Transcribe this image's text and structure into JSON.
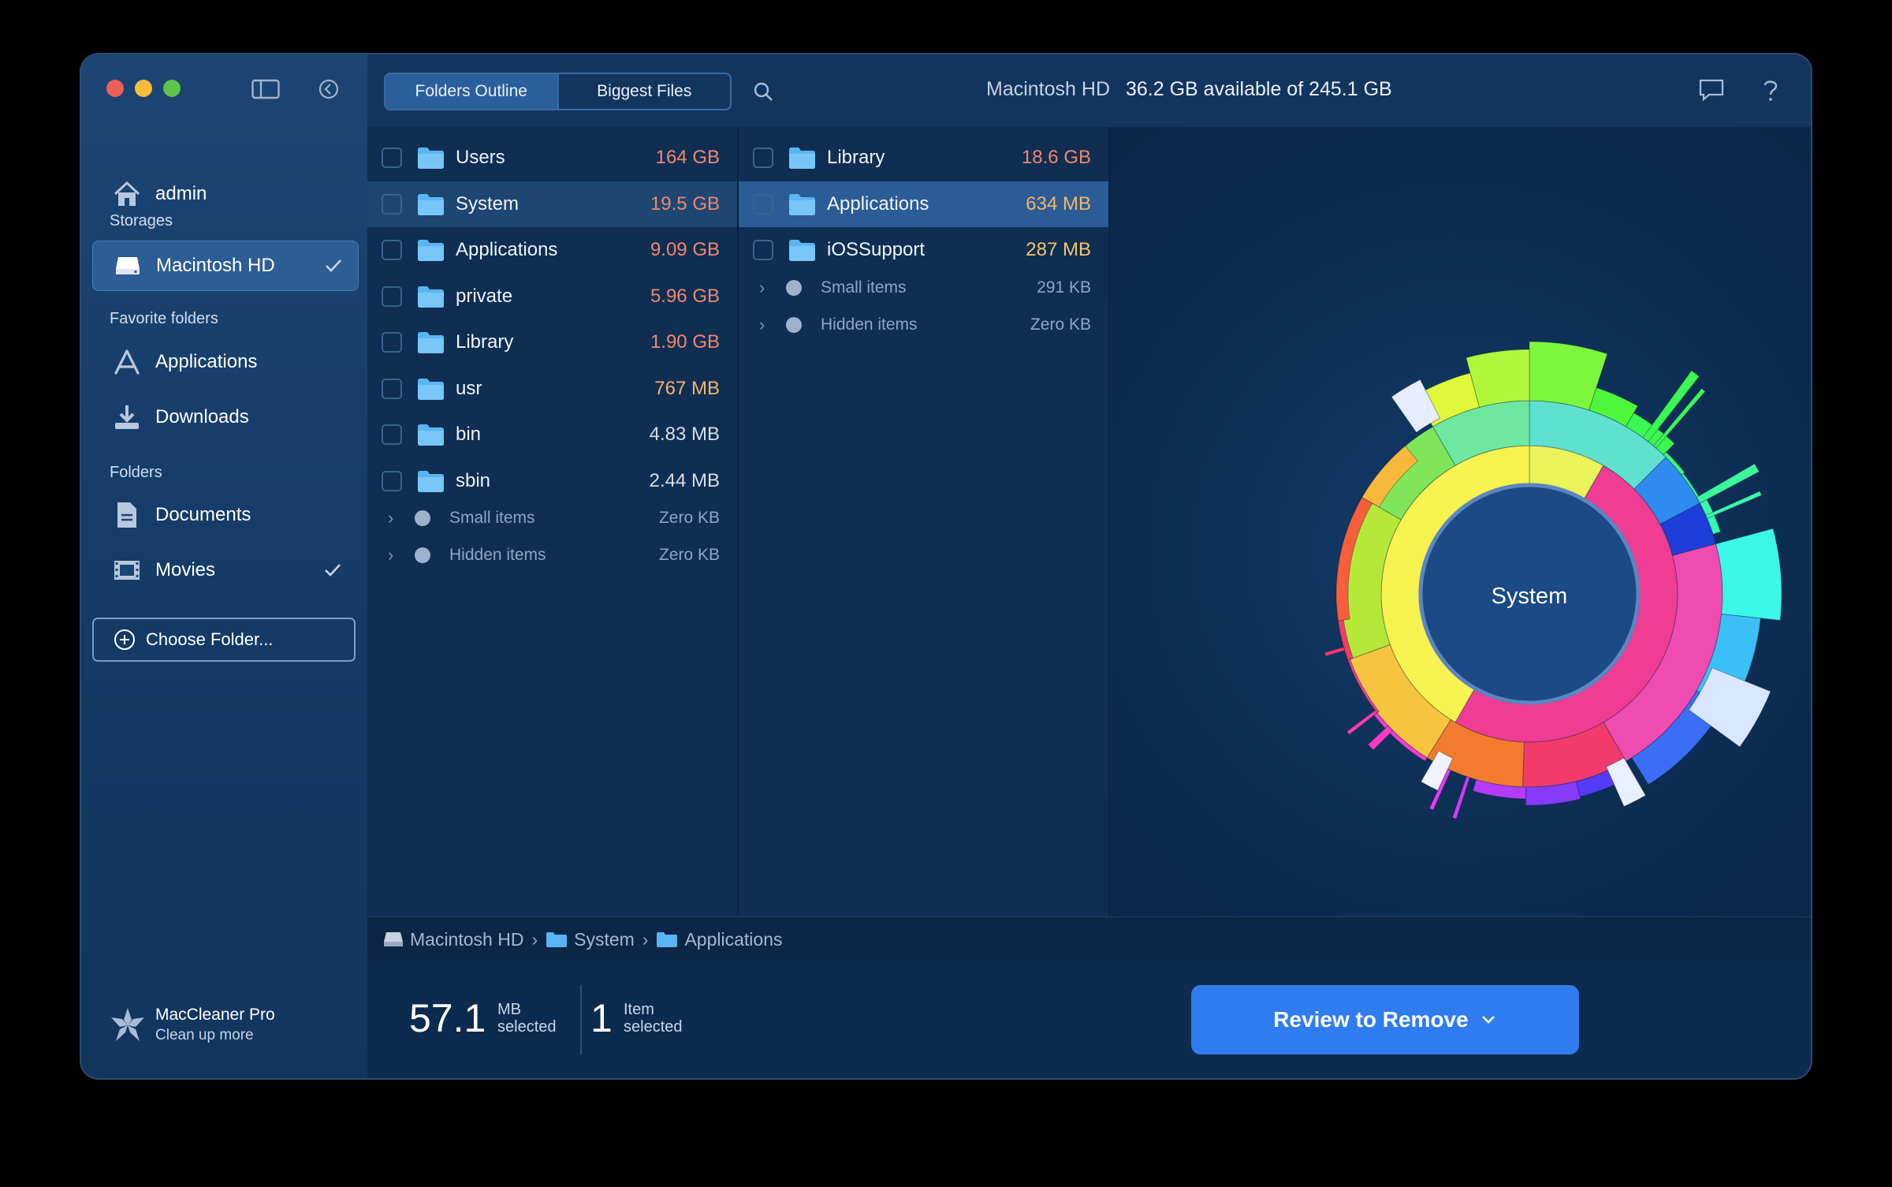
{
  "window": {
    "title_info": {
      "disk_name": "Macintosh HD",
      "availability": "36.2 GB available of 245.1 GB"
    }
  },
  "sidebar": {
    "user": {
      "label": "admin",
      "icon": "home-icon"
    },
    "storages_header": "Storages",
    "storages": [
      {
        "label": "Macintosh HD",
        "icon": "drive-icon",
        "selected": true,
        "checked": true
      }
    ],
    "favorites_header": "Favorite folders",
    "favorites": [
      {
        "label": "Applications",
        "icon": "app-store-icon"
      },
      {
        "label": "Downloads",
        "icon": "download-icon"
      }
    ],
    "folders_header": "Folders",
    "folders": [
      {
        "label": "Documents",
        "icon": "document-icon"
      },
      {
        "label": "Movies",
        "icon": "film-icon",
        "checked": true
      }
    ],
    "choose_folder": "Choose Folder...",
    "brand": {
      "name": "MacCleaner Pro",
      "tagline": "Clean up more"
    }
  },
  "toolbar": {
    "tabs": [
      {
        "label": "Folders Outline",
        "active": true
      },
      {
        "label": "Biggest Files",
        "active": false
      }
    ]
  },
  "column1": {
    "rows": [
      {
        "name": "Users",
        "size": "164 GB",
        "color": "#f0876f"
      },
      {
        "name": "System",
        "size": "19.5 GB",
        "color": "#f0876f",
        "selected": true
      },
      {
        "name": "Applications",
        "size": "9.09 GB",
        "color": "#f0876f"
      },
      {
        "name": "private",
        "size": "5.96 GB",
        "color": "#f0876f"
      },
      {
        "name": "Library",
        "size": "1.90 GB",
        "color": "#f0876f"
      },
      {
        "name": "usr",
        "size": "767 MB",
        "color": "#f3b56c"
      },
      {
        "name": "bin",
        "size": "4.83 MB",
        "color": "#d7dfea"
      },
      {
        "name": "sbin",
        "size": "2.44 MB",
        "color": "#d7dfea"
      }
    ],
    "minor": [
      {
        "name": "Small items",
        "size": "Zero KB"
      },
      {
        "name": "Hidden items",
        "size": "Zero KB"
      }
    ]
  },
  "column2": {
    "rows": [
      {
        "name": "Library",
        "size": "18.6 GB",
        "color": "#f0876f"
      },
      {
        "name": "Applications",
        "size": "634 MB",
        "color": "#f3b56c",
        "selected": true
      },
      {
        "name": "iOSSupport",
        "size": "287 MB",
        "color": "#f3c56c"
      }
    ],
    "minor": [
      {
        "name": "Small items",
        "size": "291 KB"
      },
      {
        "name": "Hidden items",
        "size": "Zero KB"
      }
    ]
  },
  "chart": {
    "center_label": "System"
  },
  "pathbar": {
    "items": [
      "Macintosh HD",
      "System",
      "Applications"
    ]
  },
  "footer": {
    "selected_size": "57.1",
    "selected_unit": "MB",
    "selected_word": "selected",
    "item_count": "1",
    "item_word": "Item",
    "item_selected": "selected",
    "review_button": "Review to Remove"
  }
}
